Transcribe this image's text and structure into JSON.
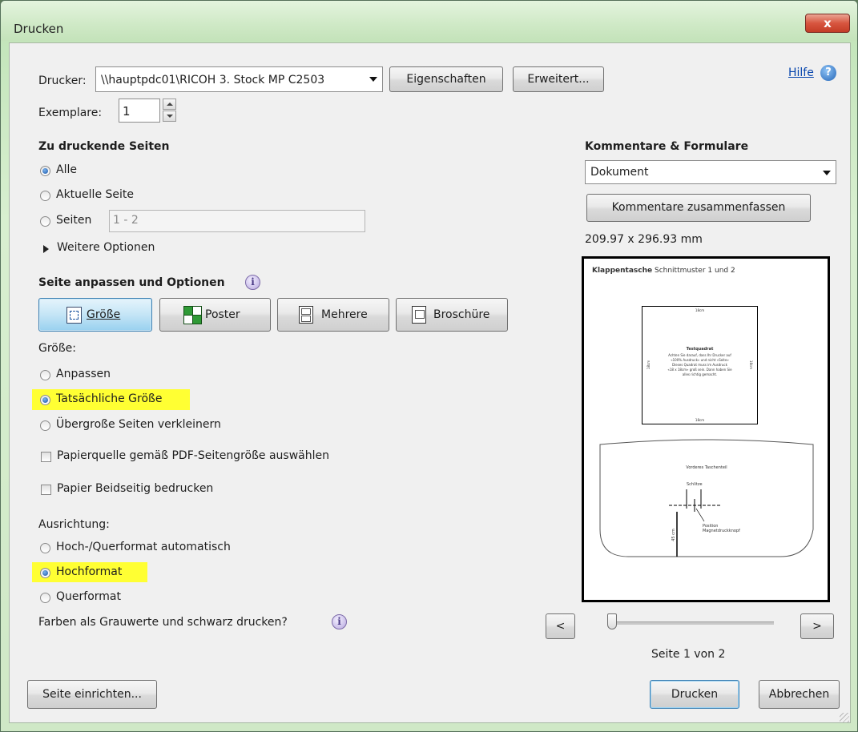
{
  "window": {
    "title": "Drucken",
    "close_label": "x"
  },
  "printer": {
    "label": "Drucker:",
    "value": "\\\\hauptpdc01\\RICOH 3. Stock MP C2503",
    "properties_button": "Eigenschaften",
    "advanced_button": "Erweitert..."
  },
  "help": {
    "label": "Hilfe",
    "icon": "help-icon"
  },
  "copies": {
    "label": "Exemplare:",
    "value": "1"
  },
  "pages": {
    "heading": "Zu druckende Seiten",
    "all": "Alle",
    "current": "Aktuelle Seite",
    "range_label": "Seiten",
    "range_value": "1 - 2",
    "more_options": "Weitere Optionen"
  },
  "fit": {
    "heading": "Seite anpassen und Optionen",
    "tabs": {
      "size": "Größe",
      "poster": "Poster",
      "multiple": "Mehrere",
      "booklet": "Broschüre"
    },
    "size_label": "Größe:",
    "fit": "Anpassen",
    "actual": "Tatsächliche Größe",
    "shrink": "Übergroße Seiten verkleinern",
    "paper_source": "Papierquelle gemäß PDF-Seitengröße auswählen",
    "duplex": "Papier Beidseitig bedrucken"
  },
  "orientation": {
    "label": "Ausrichtung:",
    "auto": "Hoch-/Querformat automatisch",
    "portrait": "Hochformat",
    "landscape": "Querformat"
  },
  "grayscale": "Farben als Grauwerte und schwarz drucken?",
  "comments": {
    "heading": "Kommentare & Formulare",
    "select_value": "Dokument",
    "summarize_button": "Kommentare zusammenfassen",
    "page_size": "209.97 x 296.93 mm"
  },
  "preview": {
    "title_bold": "Klappentasche",
    "title_rest": "Schnittmuster 1 und 2",
    "box_top": "18cm",
    "box_bottom": "18cm",
    "box_left": "18cm",
    "box_right": "18cm",
    "box_heading": "Testquadrat",
    "box_lines": [
      "Achten Sie darauf, dass Ihr Drucker auf",
      "«100% Ausdruck» und nicht «Seite»",
      "Dieses Quadrat muss im Ausdruck",
      "«18 x 18cm» groß sein. Dann haben Sie",
      "alles richtig gemacht."
    ],
    "piece_title": "Vorderes Taschenteil",
    "slit_label": "Schlitze",
    "position_label": "Position",
    "snap_label": "Magnetdruckknopf",
    "measure_label": "45 cm"
  },
  "nav": {
    "prev": "<",
    "next": ">",
    "page_status": "Seite 1 von 2"
  },
  "buttons": {
    "page_setup": "Seite einrichten...",
    "print": "Drucken",
    "cancel": "Abbrechen"
  },
  "colors": {
    "highlight": "#ffff33",
    "link": "#0645ad",
    "accent": "#1a56a8"
  }
}
